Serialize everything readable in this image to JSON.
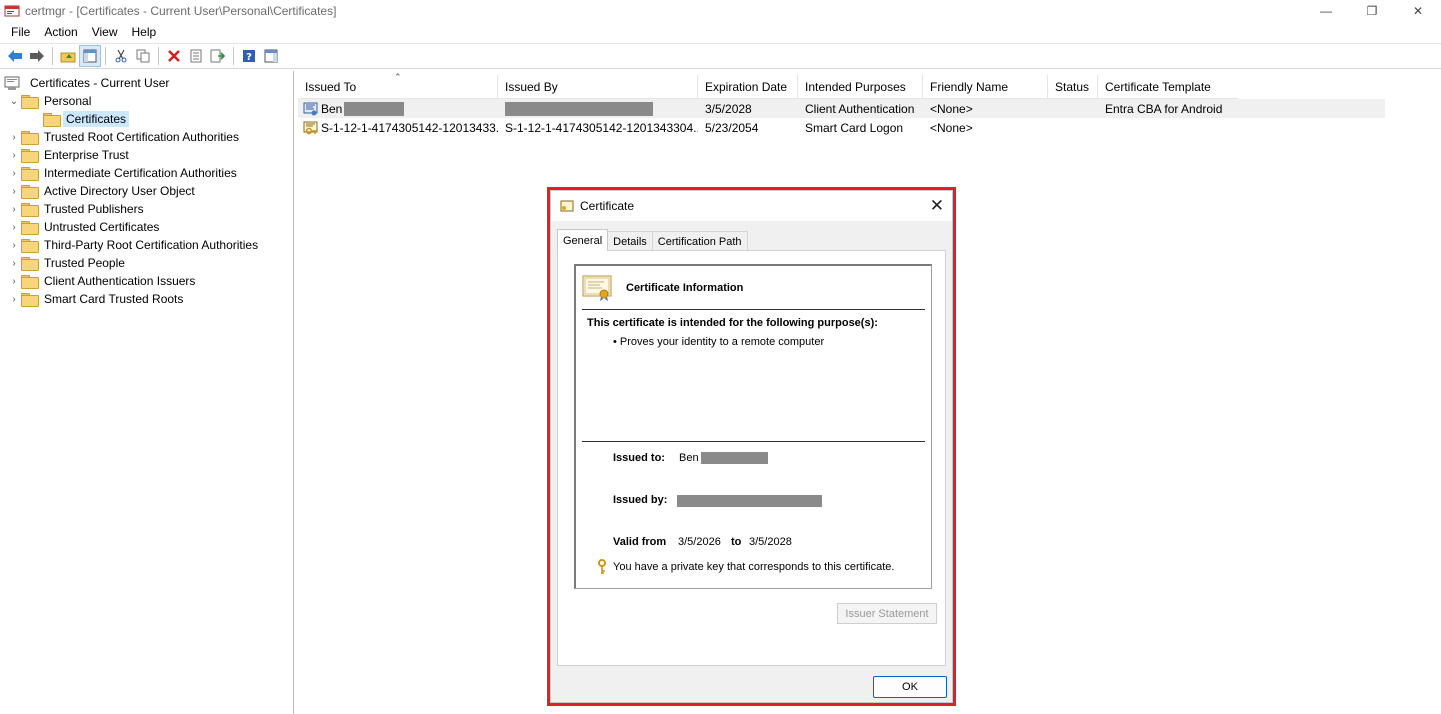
{
  "window": {
    "title": "certmgr - [Certificates - Current User\\Personal\\Certificates]",
    "controls": {
      "minimize": "—",
      "restore": "❐",
      "close": "✕"
    }
  },
  "menu": [
    "File",
    "Action",
    "View",
    "Help"
  ],
  "toolbar": {
    "buttons": [
      "back-icon",
      "forward-icon",
      "up-folder-icon",
      "show-hide-tree-icon",
      "cut-icon",
      "copy-icon",
      "delete-icon",
      "properties-icon",
      "export-icon",
      "help-icon",
      "show-action-pane-icon"
    ]
  },
  "tree": {
    "root": "Certificates - Current User",
    "personal": "Personal",
    "certificates": "Certificates",
    "stores": [
      "Trusted Root Certification Authorities",
      "Enterprise Trust",
      "Intermediate Certification Authorities",
      "Active Directory User Object",
      "Trusted Publishers",
      "Untrusted Certificates",
      "Third-Party Root Certification Authorities",
      "Trusted People",
      "Client Authentication Issuers",
      "Smart Card Trusted Roots"
    ]
  },
  "list": {
    "columns": [
      "Issued To",
      "Issued By",
      "Expiration Date",
      "Intended Purposes",
      "Friendly Name",
      "Status",
      "Certificate Template"
    ],
    "rows": [
      {
        "issued_to": "Ben",
        "issued_by": "",
        "expiration": "3/5/2028",
        "purposes": "Client Authentication",
        "friendly": "<None>",
        "status": "",
        "template": "Entra CBA for Android"
      },
      {
        "issued_to": "S-1-12-1-4174305142-12013433...",
        "issued_by": "S-1-12-1-4174305142-1201343304...",
        "expiration": "5/23/2054",
        "purposes": "Smart Card Logon",
        "friendly": "<None>",
        "status": "",
        "template": ""
      }
    ]
  },
  "dialog": {
    "title": "Certificate",
    "tabs": [
      "General",
      "Details",
      "Certification Path"
    ],
    "info_title": "Certificate Information",
    "purpose_heading": "This certificate is intended for the following purpose(s):",
    "purposes": [
      "• Proves your identity to a remote computer"
    ],
    "issued_to_label": "Issued to:",
    "issued_to_value": "Ben",
    "issued_by_label": "Issued by:",
    "valid_from_label": "Valid from",
    "valid_from": "3/5/2026",
    "to_label": "to",
    "valid_to": "3/5/2028",
    "key_note": "You have a private key that corresponds to this certificate.",
    "issuer_statement": "Issuer Statement",
    "ok": "OK"
  },
  "colors": {
    "highlight_outline": "#e01f26",
    "selection": "#cce8ff",
    "ok_border": "#0067c0"
  }
}
